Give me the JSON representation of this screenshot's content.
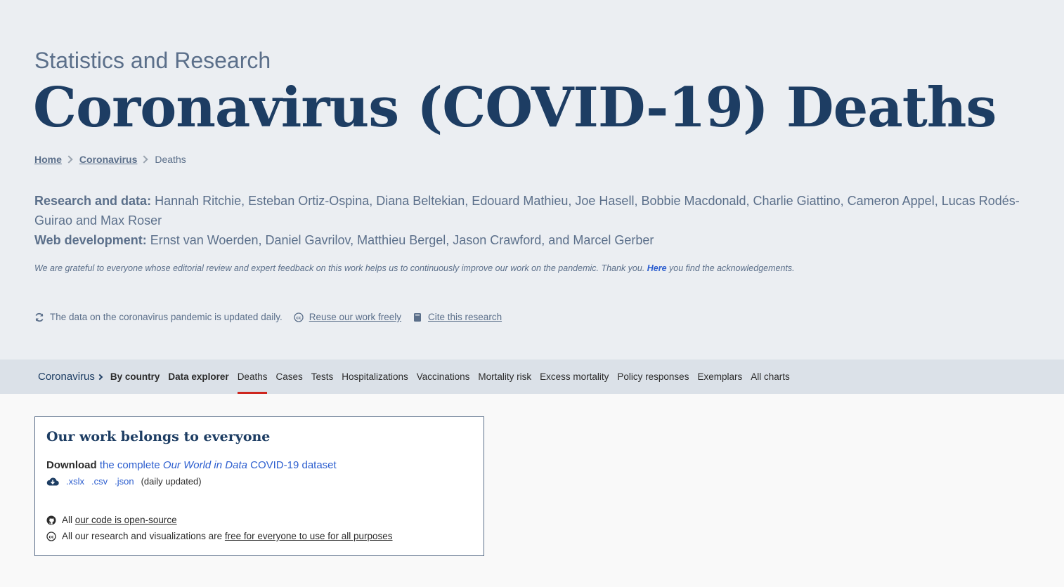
{
  "header": {
    "supertitle": "Statistics and Research",
    "title": "Coronavirus (COVID-19) Deaths"
  },
  "breadcrumb": {
    "home": "Home",
    "section": "Coronavirus",
    "current": "Deaths"
  },
  "byline": {
    "research_label": "Research and data:",
    "research_names": "Hannah Ritchie, Esteban Ortiz-Ospina, Diana Beltekian, Edouard Mathieu, Joe Hasell, Bobbie Macdonald, Charlie Giattino, Cameron Appel, Lucas Rodés-Guirao and Max Roser",
    "webdev_label": "Web development:",
    "webdev_names": "Ernst van Woerden, Daniel Gavrilov, Matthieu Bergel, Jason Crawford, and Marcel Gerber"
  },
  "thanks": {
    "before": "We are grateful to everyone whose editorial review and expert feedback on this work helps us to continuously improve our work on the pandemic. Thank you. ",
    "link": "Here",
    "after": " you find the acknowledgements."
  },
  "tools": {
    "updated": "The data on the coronavirus pandemic is updated daily.",
    "reuse": "Reuse our work freely",
    "cite": "Cite this research"
  },
  "subnav": {
    "root": "Coronavirus",
    "items": [
      {
        "label": "By country"
      },
      {
        "label": "Data explorer"
      },
      {
        "label": "Deaths"
      },
      {
        "label": "Cases"
      },
      {
        "label": "Tests"
      },
      {
        "label": "Hospitalizations"
      },
      {
        "label": "Vaccinations"
      },
      {
        "label": "Mortality risk"
      },
      {
        "label": "Excess mortality"
      },
      {
        "label": "Policy responses"
      },
      {
        "label": "Exemplars"
      },
      {
        "label": "All charts"
      }
    ]
  },
  "card": {
    "title": "Our work belongs to everyone",
    "download_label": "Download",
    "download_link_pre": "the complete ",
    "download_link_em": "Our World in Data",
    "download_link_post": " COVID-19 dataset",
    "files": [
      ".xslx",
      ".csv",
      ".json"
    ],
    "files_note": "(daily updated)",
    "code_pre": "All ",
    "code_link": "our code is open-source",
    "license_pre": "All our research and visualizations are ",
    "license_link": "free for everyone to use for all purposes"
  },
  "colors": {
    "header_bg": "#ebeef2",
    "title": "#1d3d63",
    "subnav_bg": "#dbe1e8",
    "active_underline": "#ce261e",
    "link_blue": "#2c5ecf"
  }
}
